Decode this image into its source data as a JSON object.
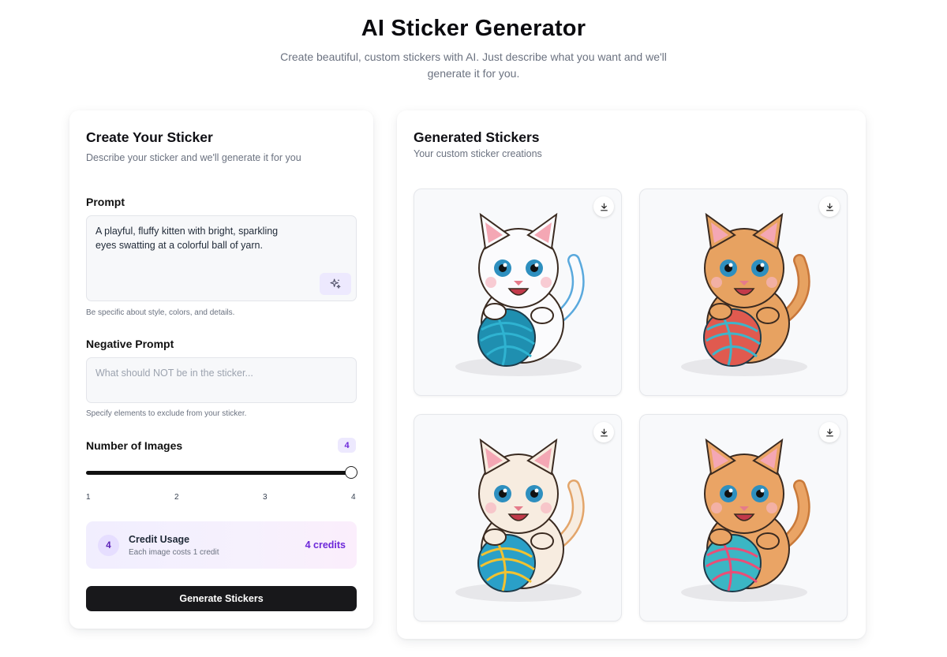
{
  "header": {
    "title": "AI Sticker Generator",
    "subtitle": "Create beautiful, custom stickers with AI. Just describe what you want and we'll generate it for you."
  },
  "form": {
    "title": "Create Your Sticker",
    "subtitle": "Describe your sticker and we'll generate it for you",
    "prompt": {
      "label": "Prompt",
      "value": "A playful, fluffy kitten with bright, sparkling eyes swatting at a colorful ball of yarn.",
      "hint": "Be specific about style, colors, and details.",
      "enhance_icon": "sparkles-icon"
    },
    "negative_prompt": {
      "label": "Negative Prompt",
      "placeholder": "What should NOT be in the sticker...",
      "hint": "Specify elements to exclude from your sticker."
    },
    "num_images": {
      "label": "Number of Images",
      "value": "4",
      "ticks": [
        "1",
        "2",
        "3",
        "4"
      ],
      "slider_fraction": 1.0
    },
    "credits": {
      "count": "4",
      "title": "Credit Usage",
      "subtitle": "Each image costs 1 credit",
      "amount": "4 credits"
    },
    "generate_label": "Generate Stickers"
  },
  "results": {
    "title": "Generated Stickers",
    "subtitle": "Your custom sticker creations",
    "download_icon": "download-icon",
    "stickers": [
      {
        "name": "kitten-sticker-1",
        "fur": "#fbfbfd",
        "accent": "#5aa9dd"
      },
      {
        "name": "kitten-sticker-2",
        "fur": "#e7a261",
        "accent": "#c8773b"
      },
      {
        "name": "kitten-sticker-3",
        "fur": "#f7ece0",
        "accent": "#e3a56a"
      },
      {
        "name": "kitten-sticker-4",
        "fur": "#eaa465",
        "accent": "#c97a3a"
      }
    ]
  },
  "colors": {
    "accent": "#6d28d9",
    "accent_soft": "#ede9fe",
    "button": "#18181b"
  }
}
